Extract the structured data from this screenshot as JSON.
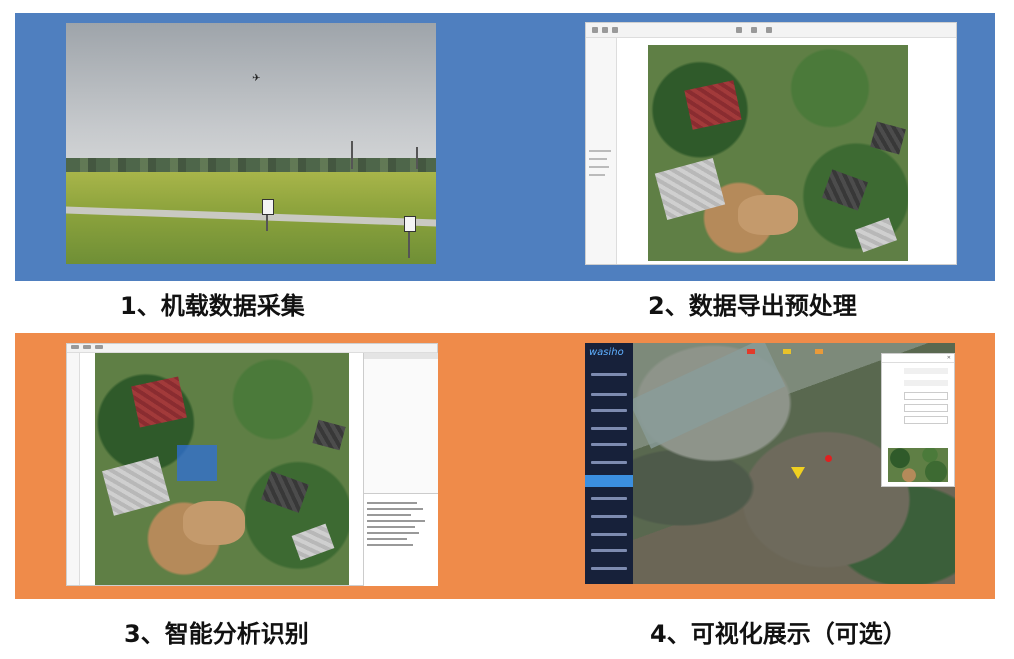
{
  "panels": [
    {
      "caption": "1、机载数据采集"
    },
    {
      "caption": "2、数据导出预处理"
    },
    {
      "caption": "3、智能分析识别"
    },
    {
      "caption": "4、可视化展示（可选）"
    }
  ],
  "dashboard": {
    "logo": "wasiho"
  },
  "colors": {
    "panel_blue": "#4f7fbf",
    "panel_orange": "#ef8b4a",
    "nav_active": "#3b8fe0",
    "sidebar_dark": "#17213a"
  }
}
